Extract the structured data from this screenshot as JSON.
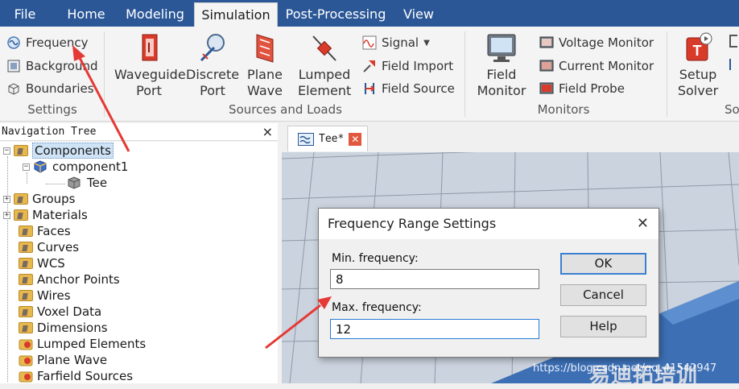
{
  "menu": {
    "tabs": [
      {
        "label": "File"
      },
      {
        "label": "Home"
      },
      {
        "label": "Modeling"
      },
      {
        "label": "Simulation"
      },
      {
        "label": "Post-Processing"
      },
      {
        "label": "View"
      }
    ],
    "active_tab": "Simulation"
  },
  "ribbon": {
    "settings": {
      "items": [
        "Frequency",
        "Background",
        "Boundaries"
      ],
      "label": "Settings"
    },
    "sources": {
      "big": [
        {
          "line1": "Waveguide",
          "line2": "Port"
        },
        {
          "line1": "Discrete",
          "line2": "Port"
        },
        {
          "line1": "Plane",
          "line2": "Wave"
        },
        {
          "line1": "Lumped",
          "line2": "Element"
        }
      ],
      "small": [
        "Signal",
        "Field Import",
        "Field Source"
      ],
      "label": "Sources and Loads"
    },
    "monitors": {
      "big": {
        "line1": "Field",
        "line2": "Monitor"
      },
      "small": [
        "Voltage Monitor",
        "Current Monitor",
        "Field Probe"
      ],
      "label": "Monitors"
    },
    "solver": {
      "big": {
        "line1": "Setup",
        "line2": "Solver"
      },
      "label": "So"
    }
  },
  "nav": {
    "title": "Navigation Tree",
    "close": "×",
    "items": [
      {
        "label": "Components",
        "expander": "−"
      },
      {
        "label": "component1",
        "expander": "−"
      },
      {
        "label": "Tee",
        "expander": ""
      },
      {
        "label": "Groups",
        "expander": "+"
      },
      {
        "label": "Materials",
        "expander": "+"
      },
      {
        "label": "Faces",
        "expander": ""
      },
      {
        "label": "Curves",
        "expander": ""
      },
      {
        "label": "WCS",
        "expander": ""
      },
      {
        "label": "Anchor Points",
        "expander": ""
      },
      {
        "label": "Wires",
        "expander": ""
      },
      {
        "label": "Voxel Data",
        "expander": ""
      },
      {
        "label": "Dimensions",
        "expander": ""
      },
      {
        "label": "Lumped Elements",
        "expander": ""
      },
      {
        "label": "Plane Wave",
        "expander": ""
      },
      {
        "label": "Farfield Sources",
        "expander": ""
      }
    ]
  },
  "document": {
    "tab_label": "Tee*"
  },
  "dialog": {
    "title": "Frequency Range Settings",
    "close": "✕",
    "min_label": "Min. frequency:",
    "min_value": "8",
    "max_label": "Max. frequency:",
    "max_value": "12",
    "ok": "OK",
    "cancel": "Cancel",
    "help": "Help"
  },
  "watermark": {
    "brand": "易迪拓培训",
    "url": "https://blog.csdn.net/qq_41542947"
  },
  "colors": {
    "menu_bar": "#2b5797",
    "annotation_arrow": "#e53935",
    "focus_border": "#2a7bd6"
  }
}
